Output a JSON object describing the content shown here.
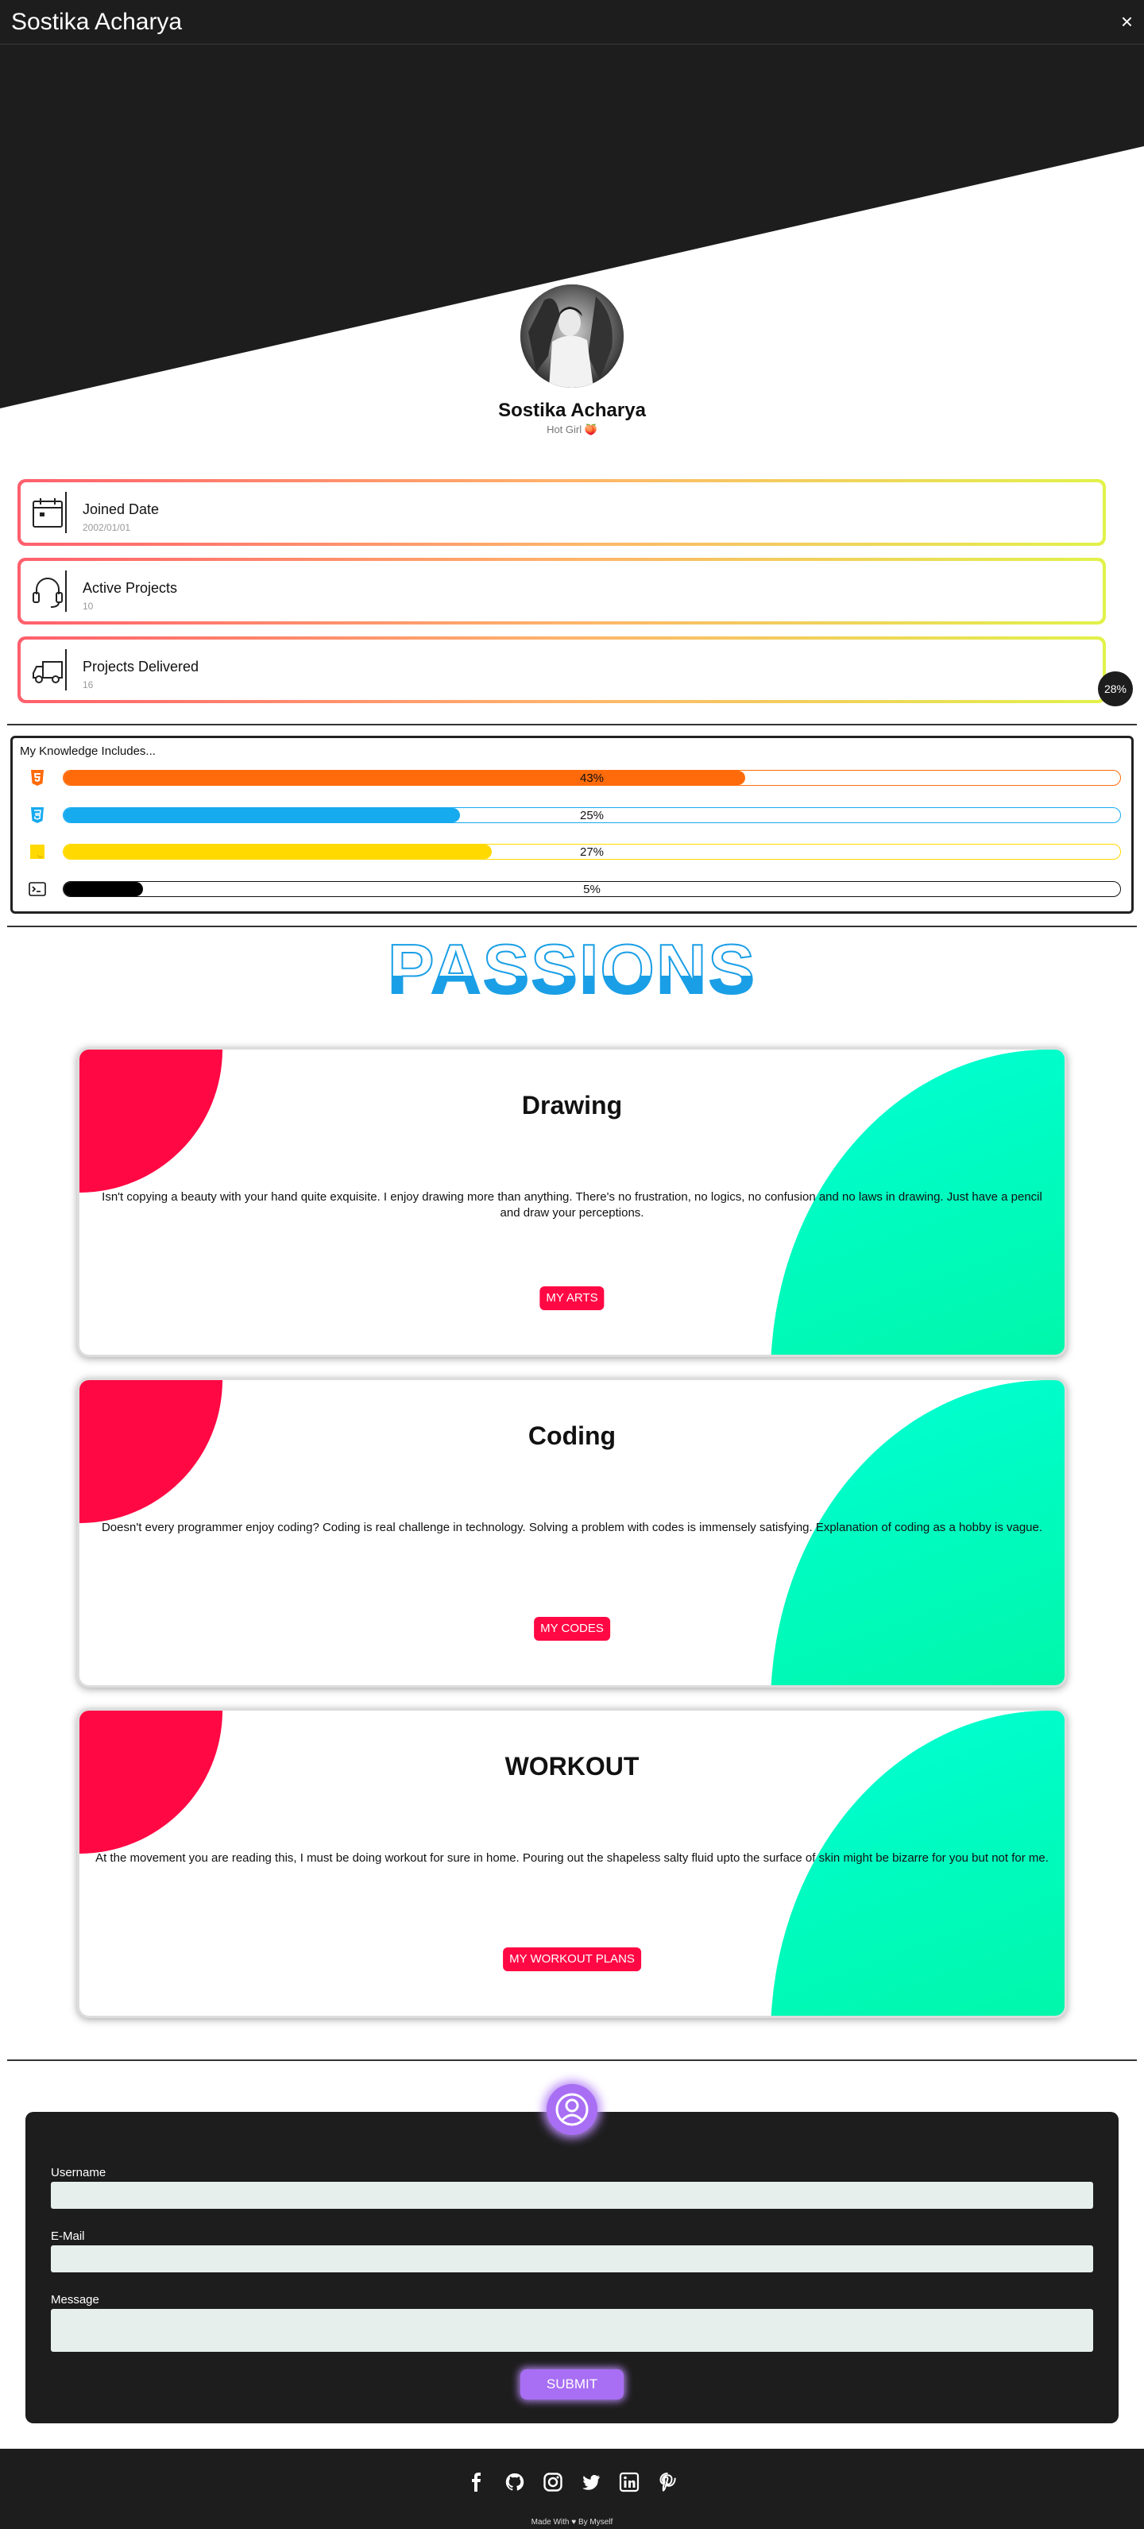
{
  "header": {
    "title": "Sostika Acharya",
    "close_icon": "×"
  },
  "profile": {
    "name": "Sostika Acharya",
    "subtitle": "Hot Girl",
    "subtitle_emoji": "🍑"
  },
  "info_cards": [
    {
      "label": "Joined Date",
      "value": "2002/01/01",
      "icon": "calendar-icon"
    },
    {
      "label": "Active Projects",
      "value": "10",
      "icon": "headset-icon"
    },
    {
      "label": "Projects Delivered",
      "value": "16",
      "icon": "delivery-truck-icon"
    }
  ],
  "scroll_progress": "28%",
  "skills": {
    "heading": "My Knowledge Includes...",
    "items": [
      {
        "name": "HTML5",
        "icon": "html5-icon",
        "percent": 43,
        "label": "43%",
        "color": "#ff6b0b"
      },
      {
        "name": "CSS3",
        "icon": "css3-icon",
        "percent": 25,
        "label": "25%",
        "color": "#16aaef"
      },
      {
        "name": "JavaScript",
        "icon": "javascript-icon",
        "percent": 27,
        "label": "27%",
        "color": "#ffd900"
      },
      {
        "name": "Terminal",
        "icon": "terminal-icon",
        "percent": 5,
        "label": "5%",
        "color": "#000000"
      }
    ]
  },
  "passions": {
    "title": "PASSIONS",
    "cards": [
      {
        "title": "Drawing",
        "description": "Isn't copying a beauty with your hand quite exquisite. I enjoy drawing more than anything. There's no frustration, no logics, no confusion and no laws in drawing. Just have a pencil and draw your perceptions.",
        "button": "MY ARTS"
      },
      {
        "title": "Coding",
        "description": "Doesn't every programmer enjoy coding? Coding is real challenge in technology. Solving a problem with codes is immensely satisfying. Explanation of coding as a hobby is vague.",
        "button": "MY CODES"
      },
      {
        "title": "WORKOUT",
        "description": "At the movement you are reading this, I must be doing workout for sure in home. Pouring out the shapeless salty fluid upto the surface of skin might be bizarre for you but not for me.",
        "button": "MY WORKOUT PLANS"
      }
    ]
  },
  "contact_form": {
    "username_label": "Username",
    "email_label": "E-Mail",
    "message_label": "Message",
    "submit_label": "SUBMIT"
  },
  "footer": {
    "credit": "Made With ♥ By Myself",
    "social_icons": [
      "facebook-icon",
      "github-icon",
      "instagram-icon",
      "twitter-icon",
      "linkedin-icon",
      "pinterest-icon"
    ]
  },
  "colors": {
    "dark": "#1d1d1d",
    "accent_red": "#ff0844",
    "accent_purple": "#a86ef3",
    "passions_blue": "#1a9fe6"
  }
}
